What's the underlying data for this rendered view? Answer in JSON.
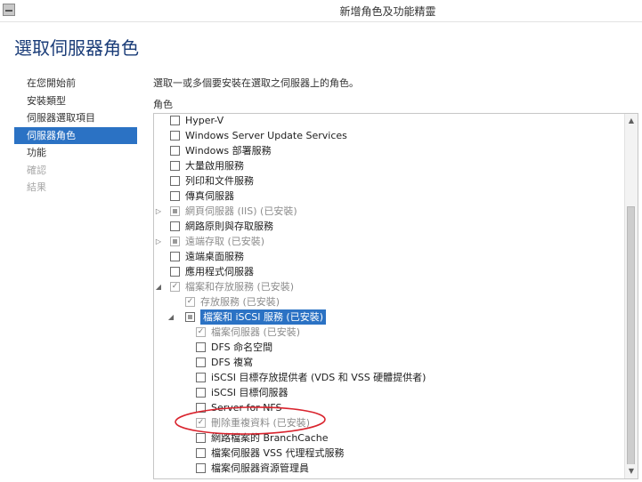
{
  "window": {
    "title": "新增角色及功能精靈"
  },
  "page": {
    "title": "選取伺服器角色"
  },
  "nav": {
    "items": [
      {
        "label": "在您開始前",
        "state": "normal"
      },
      {
        "label": "安裝類型",
        "state": "normal"
      },
      {
        "label": "伺服器選取項目",
        "state": "normal"
      },
      {
        "label": "伺服器角色",
        "state": "active"
      },
      {
        "label": "功能",
        "state": "normal"
      },
      {
        "label": "確認",
        "state": "disabled"
      },
      {
        "label": "結果",
        "state": "disabled"
      }
    ]
  },
  "main": {
    "instruction": "選取一或多個要安裝在選取之伺服器上的角色。",
    "roles_label": "角色"
  },
  "roles": [
    {
      "label": "Hyper-V",
      "level": 0,
      "check": "none",
      "expander": "",
      "grey": false
    },
    {
      "label": "Windows Server Update Services",
      "level": 0,
      "check": "none",
      "expander": "",
      "grey": false
    },
    {
      "label": "Windows 部署服務",
      "level": 0,
      "check": "none",
      "expander": "",
      "grey": false
    },
    {
      "label": "大量啟用服務",
      "level": 0,
      "check": "none",
      "expander": "",
      "grey": false
    },
    {
      "label": "列印和文件服務",
      "level": 0,
      "check": "none",
      "expander": "",
      "grey": false
    },
    {
      "label": "傳真伺服器",
      "level": 0,
      "check": "none",
      "expander": "",
      "grey": false
    },
    {
      "label": "網頁伺服器 (IIS) (已安裝)",
      "level": 0,
      "check": "partial",
      "expander": "collapsed",
      "grey": true
    },
    {
      "label": "網路原則與存取服務",
      "level": 0,
      "check": "none",
      "expander": "",
      "grey": false
    },
    {
      "label": "遠端存取 (已安裝)",
      "level": 0,
      "check": "partial",
      "expander": "collapsed",
      "grey": true
    },
    {
      "label": "遠端桌面服務",
      "level": 0,
      "check": "none",
      "expander": "",
      "grey": false
    },
    {
      "label": "應用程式伺服器",
      "level": 0,
      "check": "none",
      "expander": "",
      "grey": false
    },
    {
      "label": "檔案和存放服務 (已安裝)",
      "level": 0,
      "check": "checked",
      "expander": "expanded",
      "grey": true
    },
    {
      "label": "存放服務 (已安裝)",
      "level": 1,
      "check": "checked",
      "expander": "",
      "grey": true
    },
    {
      "label": "檔案和 iSCSI 服務 (已安裝)",
      "level": 1,
      "check": "partial",
      "expander": "expanded",
      "grey": false,
      "selected": true
    },
    {
      "label": "檔案伺服器 (已安裝)",
      "level": 2,
      "check": "checked",
      "expander": "",
      "grey": true
    },
    {
      "label": "DFS 命名空間",
      "level": 2,
      "check": "none",
      "expander": "",
      "grey": false
    },
    {
      "label": "DFS 複寫",
      "level": 2,
      "check": "none",
      "expander": "",
      "grey": false
    },
    {
      "label": "iSCSI 目標存放提供者 (VDS 和 VSS 硬體提供者)",
      "level": 2,
      "check": "none",
      "expander": "",
      "grey": false
    },
    {
      "label": "iSCSI 目標伺服器",
      "level": 2,
      "check": "none",
      "expander": "",
      "grey": false
    },
    {
      "label": "Server for NFS",
      "level": 2,
      "check": "none",
      "expander": "",
      "grey": false
    },
    {
      "label": "刪除重複資料 (已安裝)",
      "level": 2,
      "check": "checked",
      "expander": "",
      "grey": true
    },
    {
      "label": "網路檔案的 BranchCache",
      "level": 2,
      "check": "none",
      "expander": "",
      "grey": false
    },
    {
      "label": "檔案伺服器 VSS 代理程式服務",
      "level": 2,
      "check": "none",
      "expander": "",
      "grey": false
    },
    {
      "label": "檔案伺服器資源管理員",
      "level": 2,
      "check": "none",
      "expander": "",
      "grey": false
    }
  ],
  "annotation": {
    "color": "#d9232d",
    "target": "刪除重複資料 (已安裝)"
  },
  "colors": {
    "accent": "#2b72c4",
    "title": "#1a3c78"
  },
  "icons": {
    "scroll_up": "chevron-up-icon",
    "scroll_down": "chevron-down-icon"
  }
}
